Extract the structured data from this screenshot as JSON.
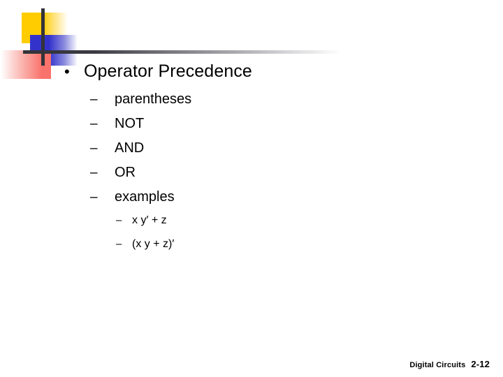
{
  "slide": {
    "background_color": "#ffffff",
    "decoration": {
      "yellow_color": "#FFCC00",
      "blue_color": "#3333CC",
      "red_color": "#F9726B",
      "line_color": "#33333A"
    },
    "level1": [
      {
        "marker": "•",
        "text": "Operator Precedence"
      }
    ],
    "level2": [
      {
        "marker": "–",
        "text": "parentheses"
      },
      {
        "marker": "–",
        "text": "NOT"
      },
      {
        "marker": "–",
        "text": "AND"
      },
      {
        "marker": "–",
        "text": "OR"
      },
      {
        "marker": "–",
        "text": "examples"
      }
    ],
    "level3": [
      {
        "marker": "–",
        "text": "x y′ + z"
      },
      {
        "marker": "–",
        "text": "(x y + z)′"
      }
    ],
    "footer": {
      "name": "Digital Circuits",
      "number": "2-12"
    }
  }
}
